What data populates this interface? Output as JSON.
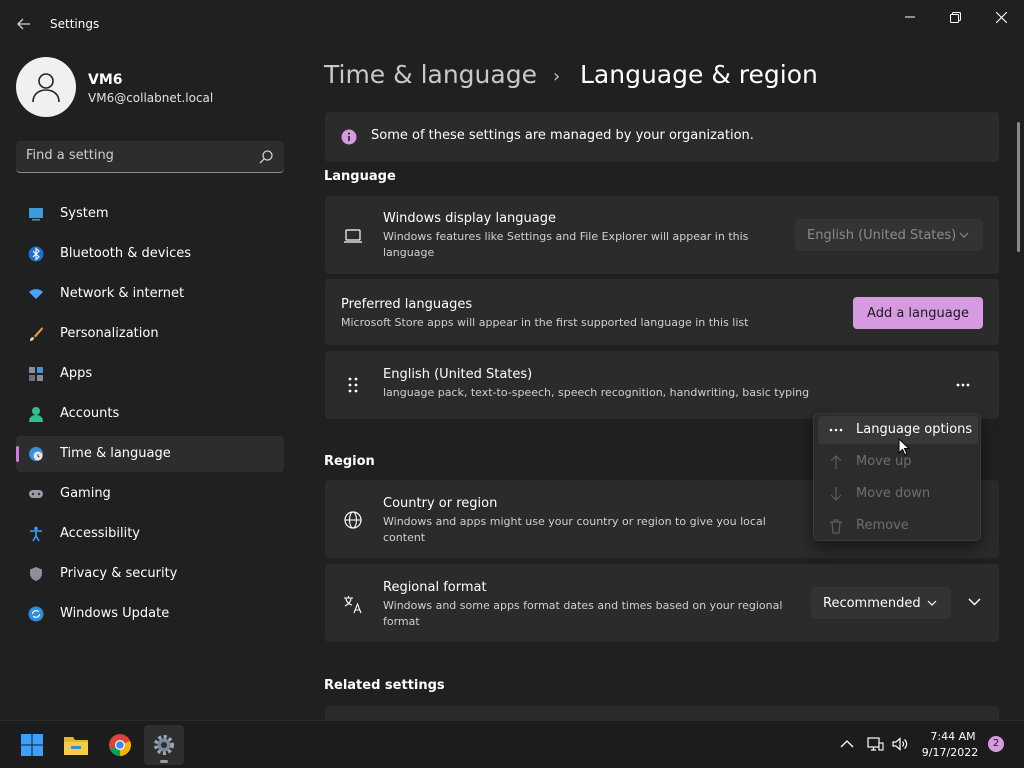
{
  "window": {
    "title": "Settings"
  },
  "profile": {
    "name": "VM6",
    "email": "VM6@collabnet.local"
  },
  "search": {
    "placeholder": "Find a setting"
  },
  "sidebar": {
    "items": [
      {
        "label": "System",
        "icon": "system-icon"
      },
      {
        "label": "Bluetooth & devices",
        "icon": "bluetooth-icon"
      },
      {
        "label": "Network & internet",
        "icon": "wifi-icon"
      },
      {
        "label": "Personalization",
        "icon": "brush-icon"
      },
      {
        "label": "Apps",
        "icon": "apps-icon"
      },
      {
        "label": "Accounts",
        "icon": "person-icon"
      },
      {
        "label": "Time & language",
        "icon": "globe-clock-icon",
        "active": true
      },
      {
        "label": "Gaming",
        "icon": "controller-icon"
      },
      {
        "label": "Accessibility",
        "icon": "accessibility-icon"
      },
      {
        "label": "Privacy & security",
        "icon": "shield-icon"
      },
      {
        "label": "Windows Update",
        "icon": "update-icon"
      }
    ]
  },
  "breadcrumb": {
    "parent": "Time & language",
    "separator": "›",
    "current": "Language & region"
  },
  "info_banner": {
    "text": "Some of these settings are managed by your organization."
  },
  "language_section": {
    "heading": "Language",
    "display_language": {
      "title": "Windows display language",
      "subtitle": "Windows features like Settings and File Explorer will appear in this language",
      "value": "English (United States)"
    },
    "preferred": {
      "title": "Preferred languages",
      "subtitle": "Microsoft Store apps will appear in the first supported language in this list",
      "button": "Add a language"
    },
    "english": {
      "title": "English (United States)",
      "subtitle": "language pack, text-to-speech, speech recognition, handwriting, basic typing"
    }
  },
  "context_menu": {
    "items": [
      {
        "label": "Language options",
        "enabled": true
      },
      {
        "label": "Move up",
        "enabled": false
      },
      {
        "label": "Move down",
        "enabled": false
      },
      {
        "label": "Remove",
        "enabled": false
      }
    ]
  },
  "region_section": {
    "heading": "Region",
    "country": {
      "title": "Country or region",
      "subtitle": "Windows and apps might use your country or region to give you local content"
    },
    "format": {
      "title": "Regional format",
      "subtitle": "Windows and some apps format dates and times based on your regional format",
      "value": "Recommended"
    }
  },
  "related": {
    "heading": "Related settings"
  },
  "taskbar": {
    "time": "7:44 AM",
    "date": "9/17/2022",
    "notifications": "2"
  },
  "colors": {
    "accent": "#d69ae0",
    "background": "#202020",
    "card": "#2b2b2b"
  }
}
